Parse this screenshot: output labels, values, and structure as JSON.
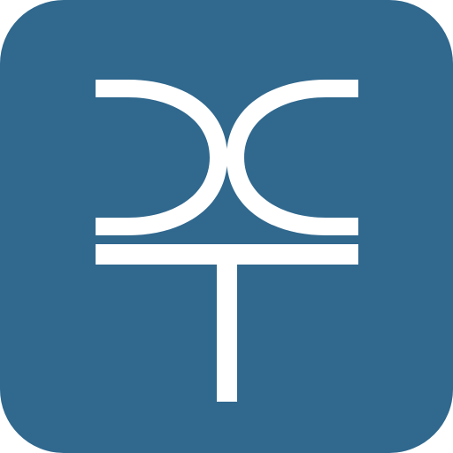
{
  "icon": {
    "name": "dct-logo-icon",
    "background_color": "#30688E",
    "mark_color": "#FFFFFF"
  }
}
